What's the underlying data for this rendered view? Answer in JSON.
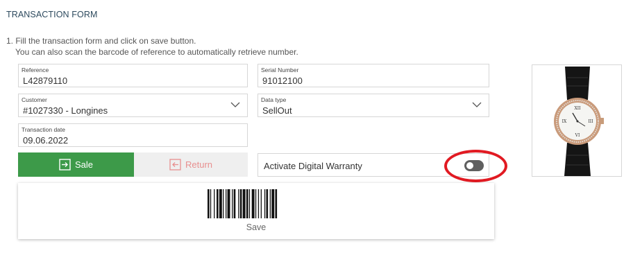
{
  "page": {
    "title": "TRANSACTION FORM",
    "instruction_line1": "1. Fill the transaction form and click on save button.",
    "instruction_line2": "You can also scan the barcode of reference to automatically retrieve number."
  },
  "form": {
    "reference": {
      "label": "Reference",
      "value": "L42879110"
    },
    "serial_number": {
      "label": "Serial Number",
      "value": "91012100"
    },
    "customer": {
      "label": "Customer",
      "value": "#1027330 - Longines"
    },
    "data_type": {
      "label": "Data type",
      "value": "SellOut"
    },
    "transaction_date": {
      "label": "Transaction date",
      "value": "09.06.2022"
    }
  },
  "actions": {
    "sale_label": "Sale",
    "return_label": "Return",
    "save_label": "Save"
  },
  "warranty": {
    "label": "Activate Digital Warranty",
    "enabled": false
  },
  "colors": {
    "sale": "#3d9a49",
    "return_text": "#e88f8f",
    "highlight": "#e11a22",
    "title": "#2d4a5e"
  },
  "icons": {
    "sale": "arrow-into-box-icon",
    "return": "arrow-out-of-box-icon",
    "dropdown": "chevron-down-icon"
  }
}
